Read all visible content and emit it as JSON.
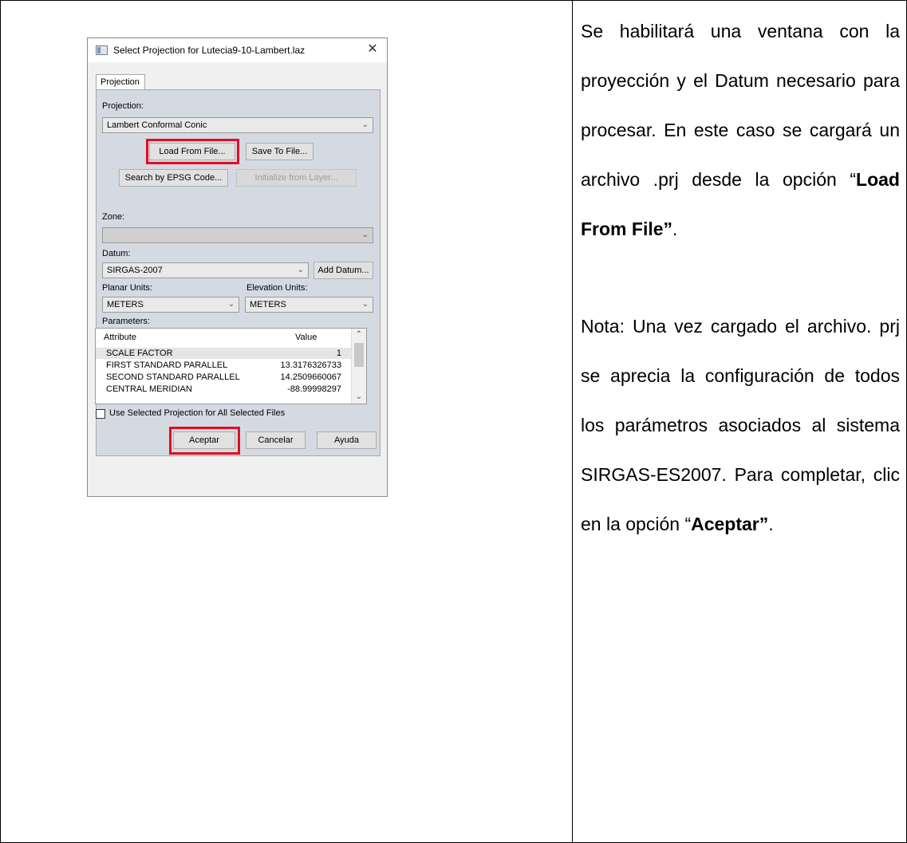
{
  "dialog": {
    "title": "Select Projection for Lutecia9-10-Lambert.laz",
    "close_glyph": "✕",
    "tab_label": "Projection",
    "projection_label": "Projection:",
    "projection_value": "Lambert Conformal Conic",
    "load_from_file": "Load From File...",
    "save_to_file": "Save To File...",
    "search_epsg": "Search by EPSG Code...",
    "initialize_from_layer": "Initialize from Layer...",
    "zone_label": "Zone:",
    "zone_value": "",
    "datum_label": "Datum:",
    "datum_value": "SIRGAS-2007",
    "add_datum": "Add Datum...",
    "planar_units_label": "Planar Units:",
    "planar_units_value": "METERS",
    "elevation_units_label": "Elevation Units:",
    "elevation_units_value": "METERS",
    "parameters_label": "Parameters:",
    "params_headers": {
      "attribute": "Attribute",
      "value": "Value"
    },
    "params": [
      {
        "attribute": "SCALE FACTOR",
        "value": "1"
      },
      {
        "attribute": "FIRST STANDARD PARALLEL",
        "value": "13.3176326733"
      },
      {
        "attribute": "SECOND STANDARD PARALLEL",
        "value": "14.2509660067"
      },
      {
        "attribute": "CENTRAL MERIDIAN",
        "value": "-88.99998297"
      }
    ],
    "use_for_all_label": "Use Selected Projection for All Selected Files",
    "use_for_all_checked": false,
    "ok_button": "Aceptar",
    "cancel_button": "Cancelar",
    "help_button": "Ayuda",
    "highlight_color": "#e00e1e"
  },
  "description": {
    "para1_text": "Se habilitará una ventana con la proyección y el Datum necesario para procesar. En este caso se cargará un archivo .prj desde la opción ",
    "para1_open_quote": "“",
    "para1_bold": "Load From File”",
    "para1_end": ".",
    "para2_text": "Nota: Una vez cargado el archivo. prj se aprecia la configuración de todos los parámetros asociados al sistema SIRGAS-ES2007. Para completar, clic en la opción ",
    "para2_open_quote": "“",
    "para2_bold": "Aceptar”",
    "para2_end": "."
  }
}
